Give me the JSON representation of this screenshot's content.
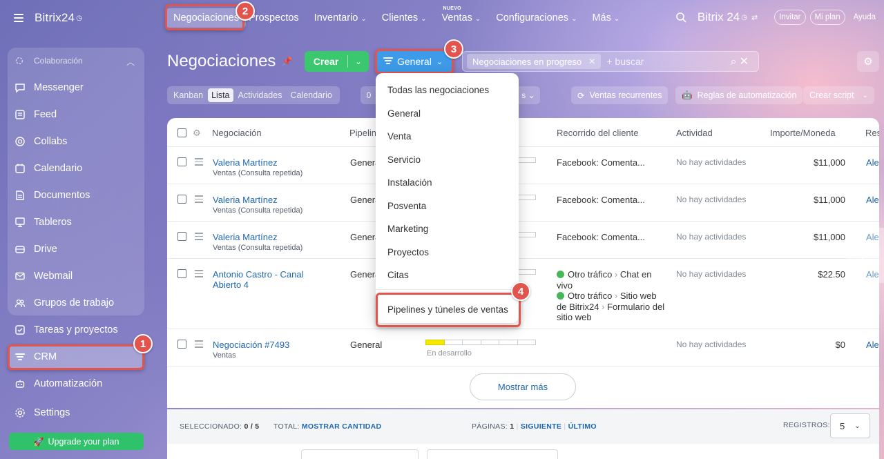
{
  "sidebar": {
    "logo": "Bitrix24",
    "group_label": "Colaboración",
    "items": [
      {
        "label": "Messenger"
      },
      {
        "label": "Feed"
      },
      {
        "label": "Collabs"
      },
      {
        "label": "Calendario"
      },
      {
        "label": "Documentos"
      },
      {
        "label": "Tableros"
      },
      {
        "label": "Drive"
      },
      {
        "label": "Webmail"
      },
      {
        "label": "Grupos de trabajo"
      },
      {
        "label": "Tareas y proyectos"
      },
      {
        "label": "CRM"
      },
      {
        "label": "Automatización"
      },
      {
        "label": "Settings"
      }
    ],
    "upgrade": "Upgrade your plan"
  },
  "topnav": {
    "items": [
      "Negociaciones",
      "Prospectos",
      "Inventario",
      "Clientes",
      "Ventas",
      "Configuraciones",
      "Más"
    ],
    "new_tag": "NUEVO",
    "brand": "Bitrix 24",
    "invite": "Invitar",
    "plan": "Mi plan",
    "help": "Ayuda"
  },
  "header": {
    "title": "Negociaciones",
    "create": "Crear",
    "pipeline": "General",
    "filter_chip": "Negociaciones en progreso",
    "search_placeholder": "+ buscar"
  },
  "views": {
    "tabs": [
      "Kanban",
      "Lista",
      "Actividades",
      "Calendario"
    ],
    "active": "Lista",
    "counter": "0",
    "recurring": "Ventas recurrentes",
    "automation": "Reglas de automatización",
    "script": "Crear script"
  },
  "table": {
    "columns": [
      "Negociación",
      "Pipeline",
      "Recorrido del cliente",
      "Actividad",
      "Importe/Moneda",
      "Res"
    ],
    "rows": [
      {
        "name": "Valeria Martínez",
        "sub": "Ventas (Consulta repetida)",
        "pipeline": "General",
        "journey": "Facebook: Comenta...",
        "activity": "No hay actividades",
        "amount": "$11,000",
        "resp": "Ale"
      },
      {
        "name": "Valeria Martínez",
        "sub": "Ventas (Consulta repetida)",
        "pipeline": "General",
        "journey": "Facebook: Comenta...",
        "activity": "No hay actividades",
        "amount": "$11,000",
        "resp": "Ale"
      },
      {
        "name": "Valeria Martínez",
        "sub": "Ventas (Consulta repetida)",
        "pipeline": "General",
        "journey": "Facebook: Comenta...",
        "activity": "No hay actividades",
        "amount": "$11,000",
        "resp": "Ale"
      },
      {
        "name": "Antonio Castro - Canal Abierto 4",
        "sub": "",
        "pipeline": "General",
        "journey_1a": "Otro tráfico",
        "journey_1b": "Chat en vivo",
        "journey_2a": "Otro tráfico",
        "journey_2b": "Sitio web de Bitrix24",
        "journey_2c": "Formulario del sitio web",
        "activity": "No hay actividades",
        "amount": "$22.50",
        "resp": "Ale"
      },
      {
        "name": "Negociación #7493",
        "sub": "Ventas",
        "pipeline": "General",
        "stage": "En desarrollo",
        "activity": "No hay actividades",
        "amount": "$0",
        "resp": "Ale"
      }
    ],
    "show_more": "Mostrar más"
  },
  "footer": {
    "selected_label": "SELECCIONADO:",
    "selected_value": "0 / 5",
    "total_label": "TOTAL:",
    "total_link": "MOSTRAR CANTIDAD",
    "pages_label": "PÁGINAS:",
    "pages_value": "1",
    "next": "SIGUIENTE",
    "last": "ÚLTIMO",
    "records_label": "REGISTROS:",
    "records_value": "5"
  },
  "dropdown": {
    "items": [
      "Todas las negociaciones",
      "General",
      "Venta",
      "Servicio",
      "Instalación",
      "Posventa",
      "Marketing",
      "Proyectos",
      "Citas"
    ],
    "footer_item": "Pipelines y túneles de ventas"
  },
  "callouts": [
    "1",
    "2",
    "3",
    "4"
  ],
  "colors": {
    "accent_green": "#3bc76e",
    "accent_blue": "#3d9be9",
    "callout_red": "#e2554e",
    "link_blue": "#2067b0"
  }
}
